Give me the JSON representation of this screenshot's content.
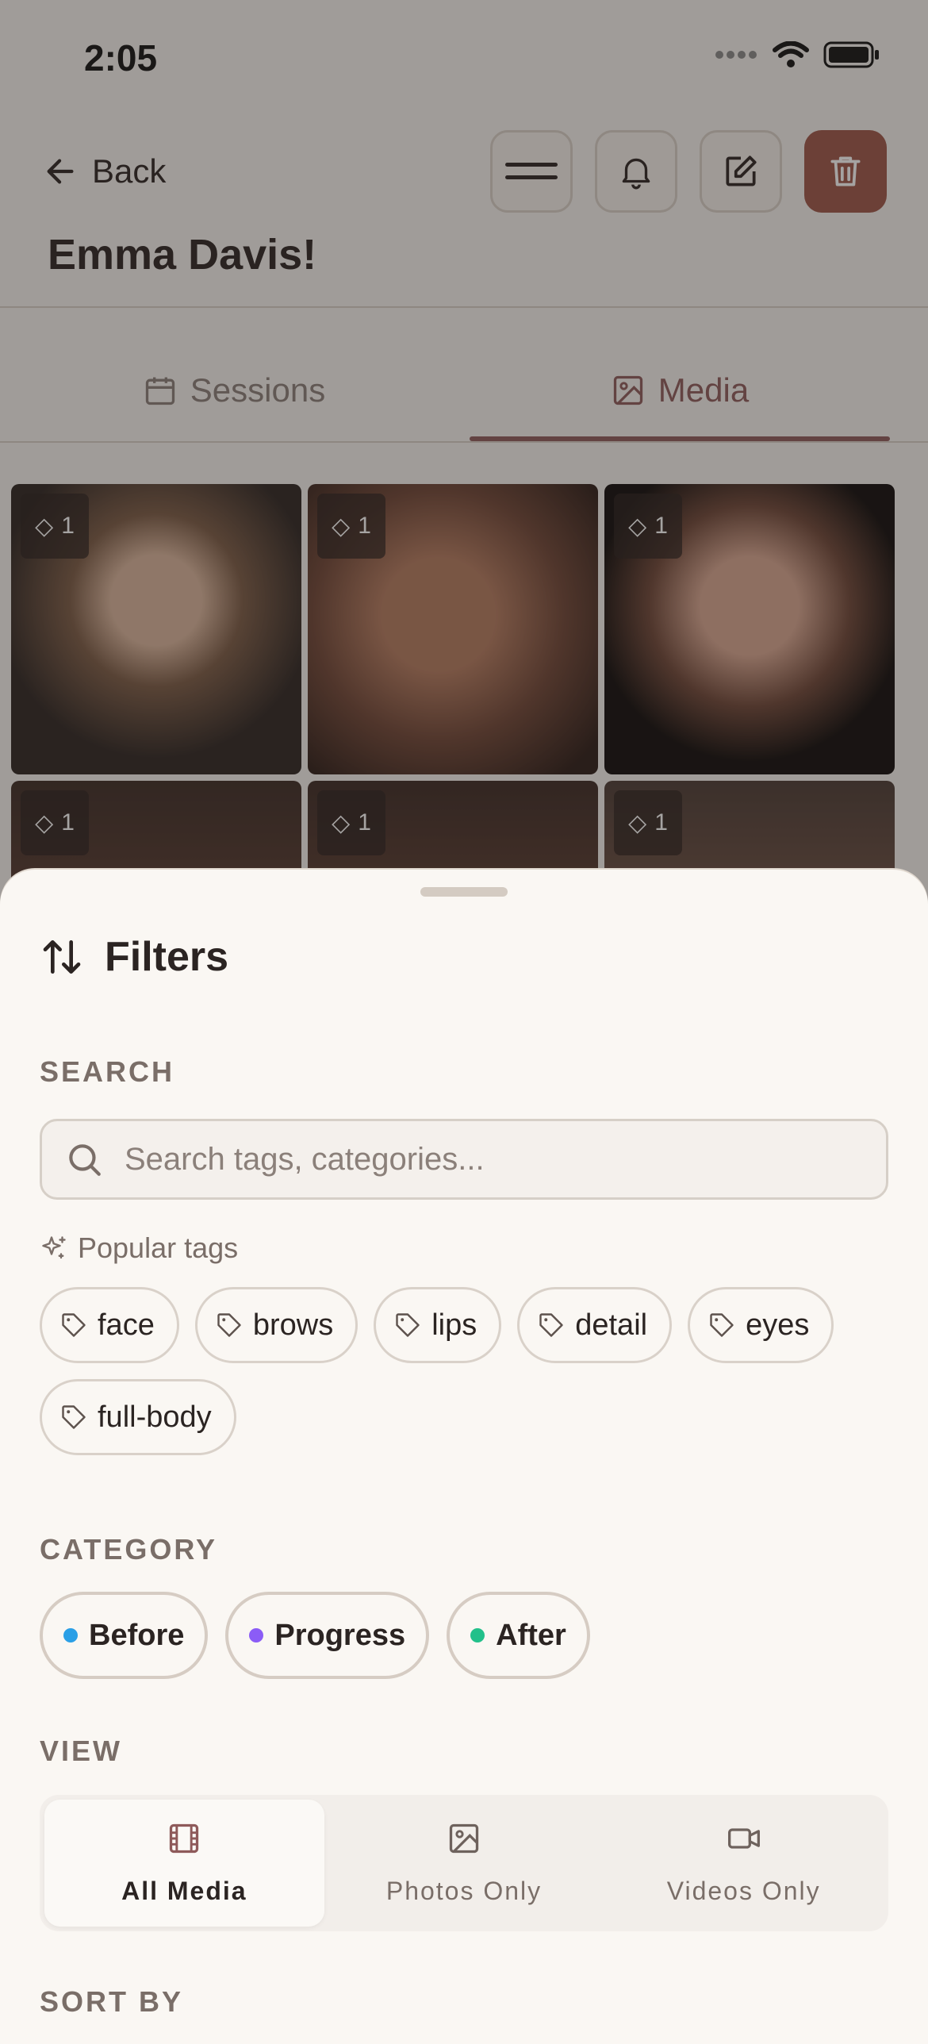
{
  "status": {
    "time": "2:05"
  },
  "header": {
    "back_label": "Back",
    "title": "Emma Davis!"
  },
  "tabs": [
    {
      "label": "Sessions",
      "active": false
    },
    {
      "label": "Media",
      "active": true
    }
  ],
  "media": {
    "tiles": [
      {
        "tag_count": "1"
      },
      {
        "tag_count": "1"
      },
      {
        "tag_count": "1"
      },
      {
        "tag_count": "1"
      },
      {
        "tag_count": "1"
      },
      {
        "tag_count": "1"
      }
    ]
  },
  "sheet": {
    "title": "Filters",
    "search_label": "SEARCH",
    "search_placeholder": "Search tags, categories...",
    "popular_label": "Popular tags",
    "tags": [
      "face",
      "brows",
      "lips",
      "detail",
      "eyes",
      "full-body"
    ],
    "category_label": "CATEGORY",
    "categories": [
      {
        "label": "Before",
        "color": "#2a9fe6"
      },
      {
        "label": "Progress",
        "color": "#8b5cf6"
      },
      {
        "label": "After",
        "color": "#22c08a"
      }
    ],
    "view_label": "VIEW",
    "views": [
      {
        "label": "All Media",
        "active": true
      },
      {
        "label": "Photos Only",
        "active": false
      },
      {
        "label": "Videos Only",
        "active": false
      }
    ],
    "sort_label": "SORT BY"
  },
  "colors": {
    "accent": "#8e5a5a",
    "danger": "#9e5548",
    "sheet_bg": "#faf7f3"
  }
}
